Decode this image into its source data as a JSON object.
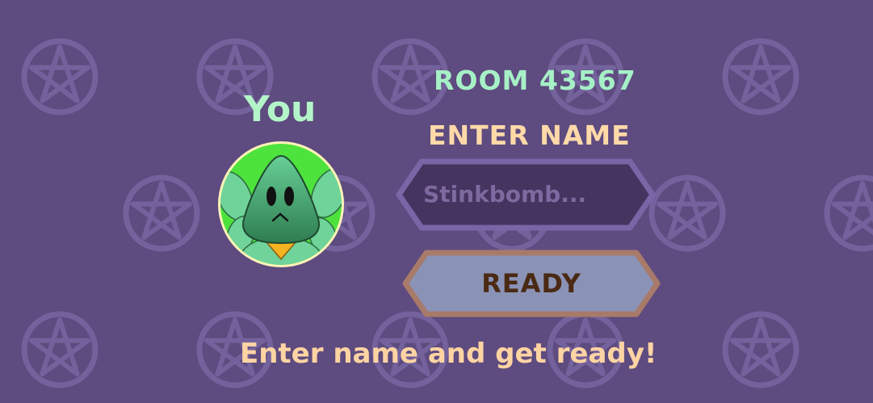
{
  "lobby": {
    "player_label": "You",
    "room_title": "ROOM 43567",
    "name_label": "ENTER NAME",
    "name_input": {
      "value": "",
      "placeholder": "Stinkbomb..."
    },
    "ready_label": "READY",
    "status_message": "Enter name and get ready!"
  },
  "background": {
    "pattern_icon": "pentagram-icon",
    "color": "#5e4b7f"
  },
  "avatar": {
    "character_icon": "green-blob-character-icon"
  },
  "colors": {
    "mint": "#a6f0c6",
    "peach": "#ffd9a8",
    "input_fill": "#44345f",
    "button_fill": "#8a93b6",
    "button_text": "#4a2a14"
  }
}
